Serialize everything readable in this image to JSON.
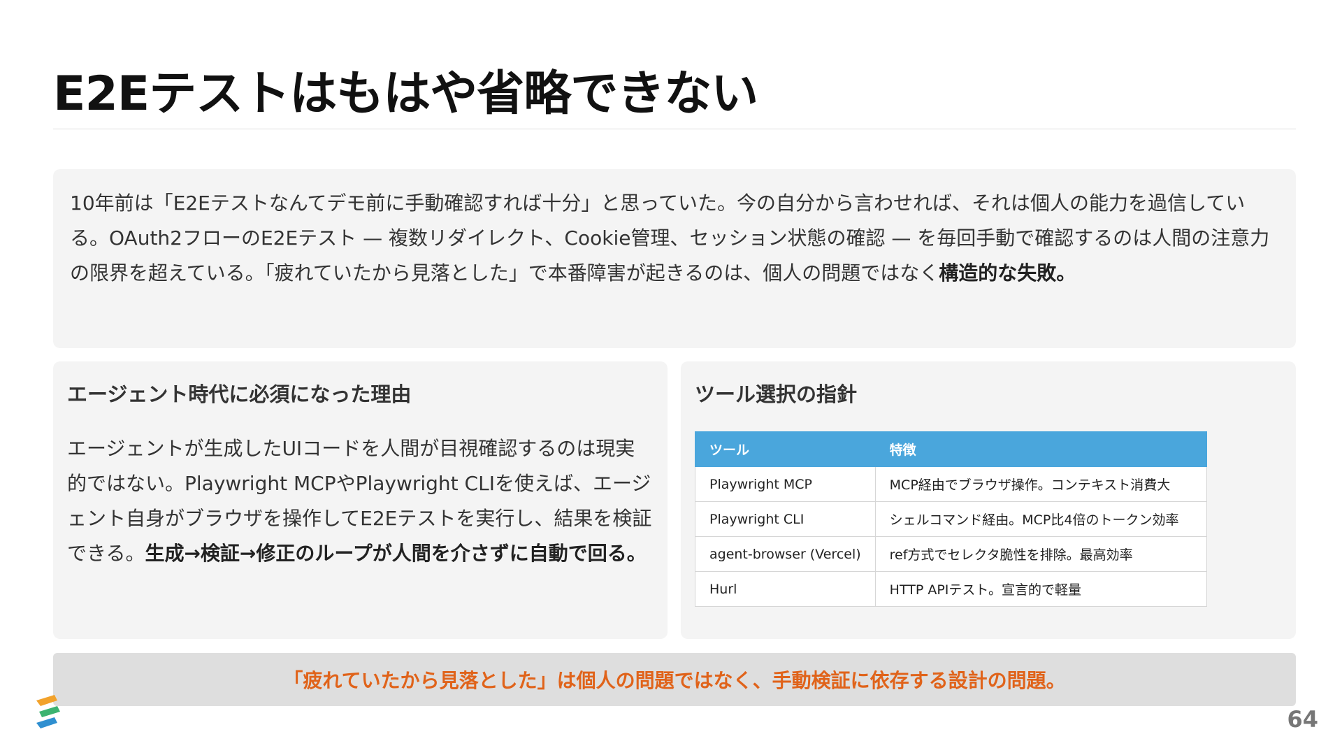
{
  "slide": {
    "title": "E2Eテストはもはや省略できない",
    "page_number": "64"
  },
  "intro": {
    "text": "10年前は「E2Eテストなんてデモ前に手動確認すれば十分」と思っていた。今の自分から言わせれば、それは個人の能力を過信している。OAuth2フローのE2Eテスト — 複数リダイレクト、Cookie管理、セッション状態の確認 — を毎回手動で確認するのは人間の注意力の限界を超えている。「疲れていたから見落とした」で本番障害が起きるのは、個人の問題ではなく",
    "emphasis": "構造的な失敗。"
  },
  "left_card": {
    "heading": "エージェント時代に必須になった理由",
    "text": "エージェントが生成したUIコードを人間が目視確認するのは現実的ではない。Playwright MCPやPlaywright CLIを使えば、エージェント自身がブラウザを操作してE2Eテストを実行し、結果を検証できる。",
    "emphasis": "生成→検証→修正のループが人間を介さずに自動で回る。"
  },
  "right_card": {
    "heading": "ツール選択の指針",
    "table": {
      "headers": [
        "ツール",
        "特徴"
      ],
      "rows": [
        [
          "Playwright MCP",
          "MCP経由でブラウザ操作。コンテキスト消費大"
        ],
        [
          "Playwright CLI",
          "シェルコマンド経由。MCP比4倍のトークン効率"
        ],
        [
          "agent-browser (Vercel)",
          "ref方式でセレクタ脆性を排除。最高効率"
        ],
        [
          "Hurl",
          "HTTP APIテスト。宣言的で軽量"
        ]
      ]
    }
  },
  "callout": {
    "text": "「疲れていたから見落とした」は個人の問題ではなく、手動検証に依存する設計の問題。"
  },
  "colors": {
    "table_header": "#4aa6dc",
    "callout_text": "#e0631a",
    "card_bg": "#f4f4f4",
    "callout_bg": "#dedede"
  },
  "icons": {
    "logo": "brand-logo-icon"
  }
}
